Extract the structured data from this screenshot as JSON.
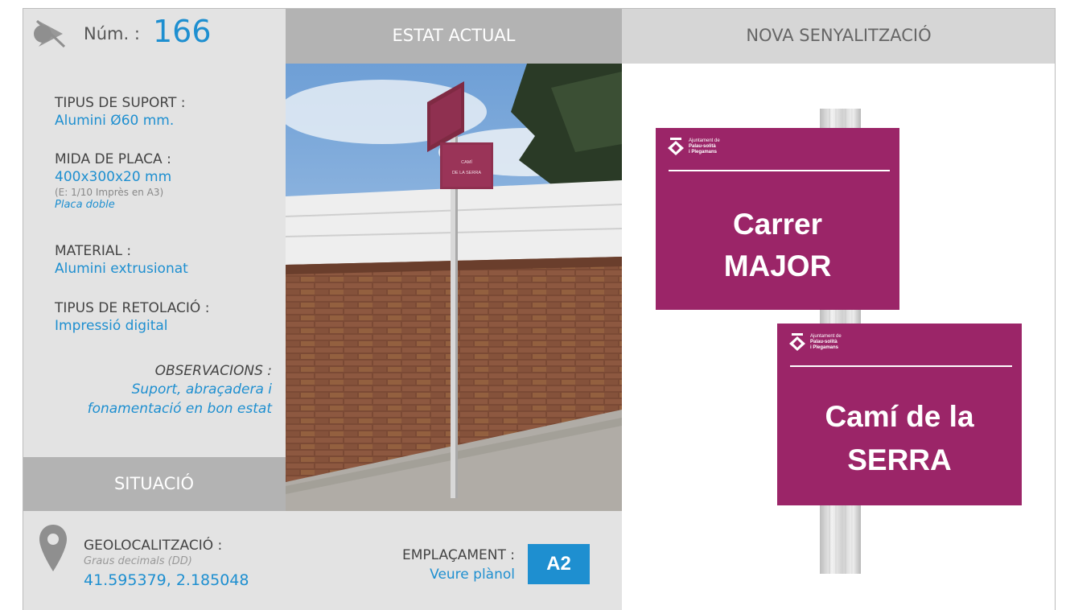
{
  "header": {
    "num_label": "Núm. :",
    "num_value": "166",
    "estat_actual": "ESTAT ACTUAL",
    "nova_senyalitzacio": "NOVA SENYALITZACIÓ"
  },
  "specs": {
    "suport_label": "TIPUS DE SUPORT :",
    "suport_value": "Alumini Ø60 mm.",
    "mida_label": "MIDA DE PLACA :",
    "mida_value": "400x300x20 mm",
    "mida_scale": "(E: 1/10 Imprès en A3)",
    "mida_note": "Placa doble",
    "material_label": "MATERIAL :",
    "material_value": "Alumini extrusionat",
    "retolacio_label": "TIPUS DE RETOLACIÓ :",
    "retolacio_value": "Impressió digital",
    "obs_label": "OBSERVACIONS :",
    "obs_line1": "Suport, abraçadera i",
    "obs_line2": "fonamentació en bon estat"
  },
  "situacio": {
    "title": "SITUACIÓ",
    "geo_label": "GEOLOCALITZACIÓ :",
    "geo_sub": "Graus decimals (DD)",
    "geo_value": "41.595379, 2.185048",
    "empl_label": "EMPLAÇAMENT :",
    "empl_value": "Veure plànol",
    "empl_badge": "A2"
  },
  "photo_signs": {
    "top": "CAMÍ DE LA SERRA",
    "top_line1": "CAMÍ",
    "top_line2": "DE LA SERRA"
  },
  "signs": [
    {
      "logo_line1": "Ajuntament de",
      "logo_line2": "Palau-solità",
      "logo_line3": "i Plegamans",
      "line1": "Carrer",
      "line2": "MAJOR"
    },
    {
      "logo_line1": "Ajuntament de",
      "logo_line2": "Palau-solità",
      "logo_line3": "i Plegamans",
      "line1": "Camí de la",
      "line2": "SERRA"
    }
  ],
  "colors": {
    "accent_blue": "#1e8fd0",
    "sign_magenta": "#9b2568",
    "panel_gray": "#e3e3e3",
    "band_gray": "#b3b3b3"
  },
  "icons": [
    "direction-pointer-icon",
    "map-pin-icon",
    "municipal-shield-icon"
  ]
}
